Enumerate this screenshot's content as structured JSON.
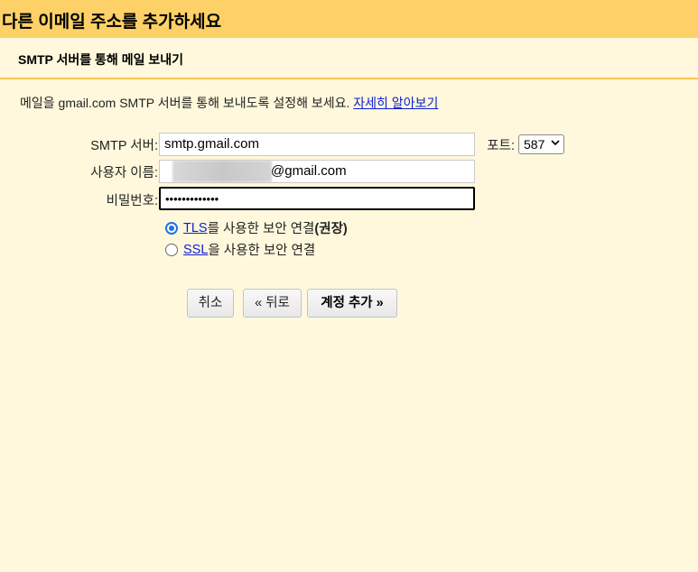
{
  "dialog": {
    "title": "다른 이메일 주소를 추가하세요",
    "section_title": "SMTP 서버를 통해 메일 보내기",
    "description": "메일을 gmail.com SMTP 서버를 통해 보내도록 설정해 보세요.",
    "learn_more": "자세히 알아보기"
  },
  "form": {
    "smtp_server_label": "SMTP 서버:",
    "smtp_server_value": "smtp.gmail.com",
    "port_label": "포트:",
    "port_value": "587",
    "username_label": "사용자 이름:",
    "username_suffix": "@gmail.com",
    "password_label": "비밀번호:",
    "password_value": "•••••••••••••",
    "tls_link": "TLS",
    "tls_text": "를 사용한 보안 연결",
    "tls_recommended": "(권장)",
    "ssl_link": "SSL",
    "ssl_text": "을 사용한 보안 연결",
    "selected_security": "TLS"
  },
  "buttons": {
    "cancel": "취소",
    "back": "« 뒤로",
    "add_account": "계정 추가 »"
  },
  "colors": {
    "title_bar": "#fdd167",
    "background": "#fff8dc",
    "link": "#0b1fd1",
    "radio_selected": "#1a73e8"
  }
}
